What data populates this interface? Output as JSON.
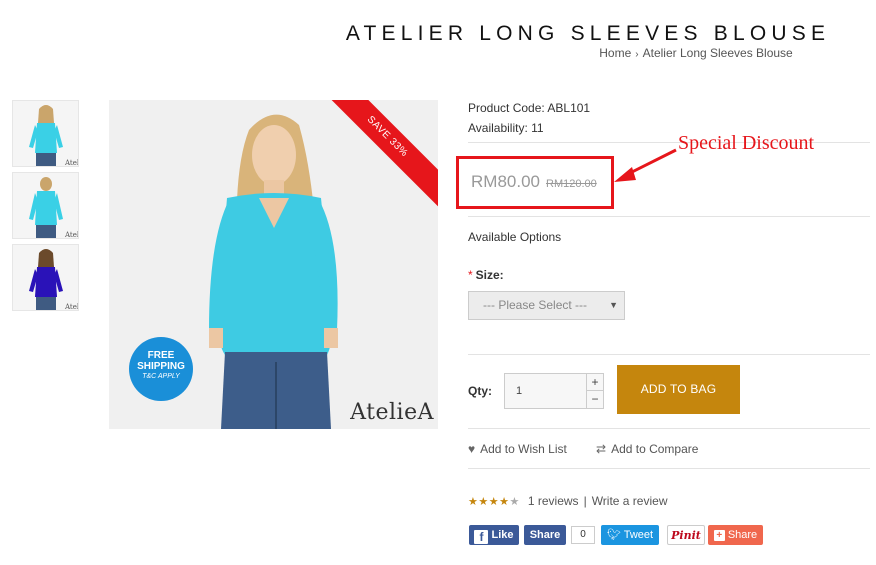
{
  "product": {
    "title": "ATELIER LONG SLEEVES BLOUSE",
    "code_line": "Product Code: ABL101",
    "availability_line": "Availability: 11",
    "price_new": "RM80.00",
    "price_old": "RM120.00",
    "ribbon": "SAVE 33%",
    "brand_mark": "AtelieA"
  },
  "breadcrumb": {
    "home": "Home",
    "separator": "›",
    "current": "Atelier Long Sleeves Blouse"
  },
  "annotation": {
    "text": "Special Discount",
    "color": "#e6161b"
  },
  "badge": {
    "line1": "FREE",
    "line2": "SHIPPING",
    "line3": "T&C APPLY"
  },
  "options": {
    "heading": "Available Options",
    "size_label": "Size:",
    "required_mark": "*",
    "size_placeholder": "--- Please Select ---"
  },
  "cart": {
    "qty_label": "Qty:",
    "qty_value": "1",
    "qty_up": "+",
    "qty_down": "−",
    "add_label": "ADD TO BAG",
    "add_color": "#c5860d"
  },
  "actions": {
    "wishlist": "Add to Wish List",
    "compare": "Add to Compare"
  },
  "reviews": {
    "rating": 4,
    "out_of": 5,
    "count_text": "1 reviews",
    "separator": "|",
    "write": "Write a review"
  },
  "social": {
    "fb_like": "Like",
    "fb_share": "Share",
    "fb_count": "0",
    "tweet": "Tweet",
    "pinit": "Pinit",
    "gplus_share": "Share"
  },
  "colors": {
    "accent_red": "#e6161b",
    "brand_gold": "#c5860d",
    "facebook": "#3b5998",
    "twitter": "#1b95e0"
  }
}
